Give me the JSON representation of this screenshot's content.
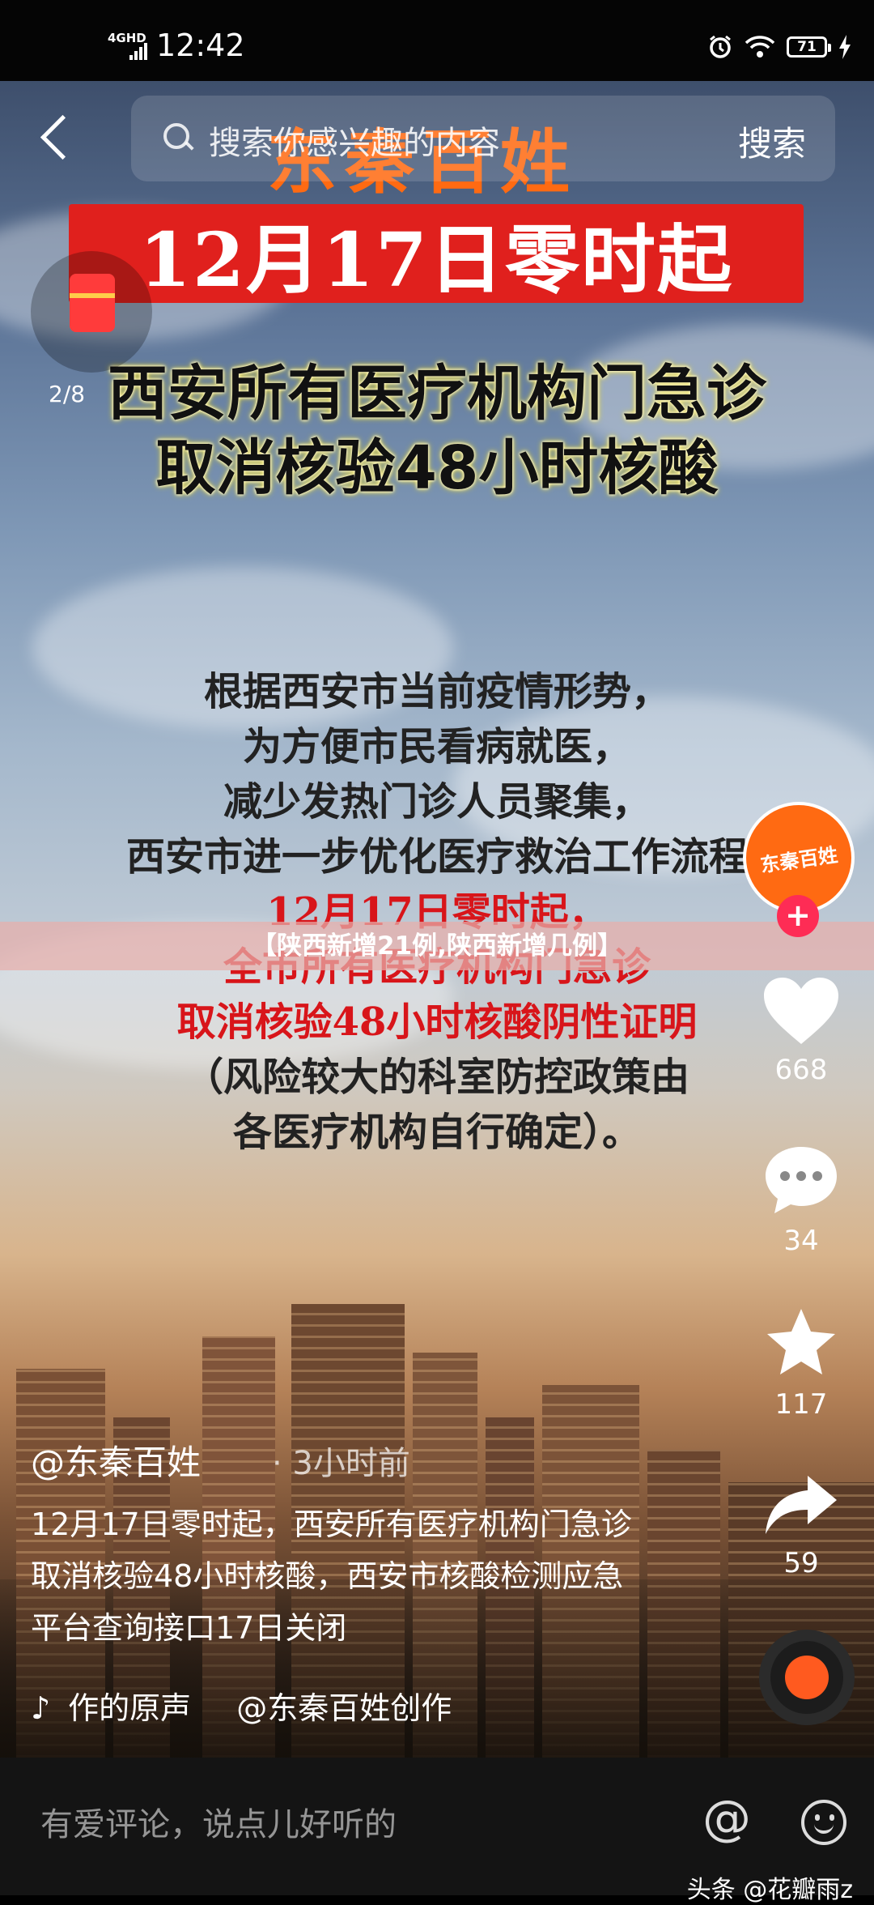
{
  "status_bar": {
    "network": "4GHD",
    "time": "12:42",
    "battery": "71"
  },
  "search": {
    "placeholder": "搜索你感兴趣的内容",
    "button": "搜索"
  },
  "video": {
    "brand_text": "东秦百姓",
    "date_banner": "12月17日零时起",
    "headline": [
      "西安所有医疗机构门急诊",
      "取消核验48小时核酸"
    ],
    "body_lines_dark": [
      "根据西安市当前疫情形势，",
      "为方便市民看病就医，",
      "减少发热门诊人员聚集，",
      "西安市进一步优化医疗救治工作流程"
    ],
    "body_lines_red": [
      "12月17日零时起，",
      "全市所有医疗机构门急诊",
      "取消核验48小时核酸阴性证明"
    ],
    "body_lines_end": [
      "（风险较大的科室防控政策由",
      "各医疗机构自行确定）。"
    ]
  },
  "red_packet": {
    "count": "2/8"
  },
  "overlay_title": "【陕西新增21例,陕西新增几例】",
  "sidebar": {
    "avatar_text": "东秦百姓",
    "follow_label": "+",
    "likes": "668",
    "comments": "34",
    "favorites": "117",
    "shares": "59"
  },
  "post": {
    "author": "@东秦百姓",
    "time_ago": "· 3小时前",
    "caption": "12月17日零时起，西安所有医疗机构门急诊取消核验48小时核酸，西安市核酸检测应急平台查询接口17日关闭",
    "music_note": "♪",
    "sound_name": "作的原声",
    "sound_author": "@东秦百姓创作"
  },
  "bottom_bar": {
    "comment_placeholder": "有爱评论，说点儿好听的",
    "at_symbol": "@"
  },
  "watermark": "头条 @花瓣雨z",
  "colors": {
    "like": "#ffffff",
    "follow": "#fe2c55",
    "banner_red": "#e0201d",
    "brand_orange": "#ff6a12"
  }
}
